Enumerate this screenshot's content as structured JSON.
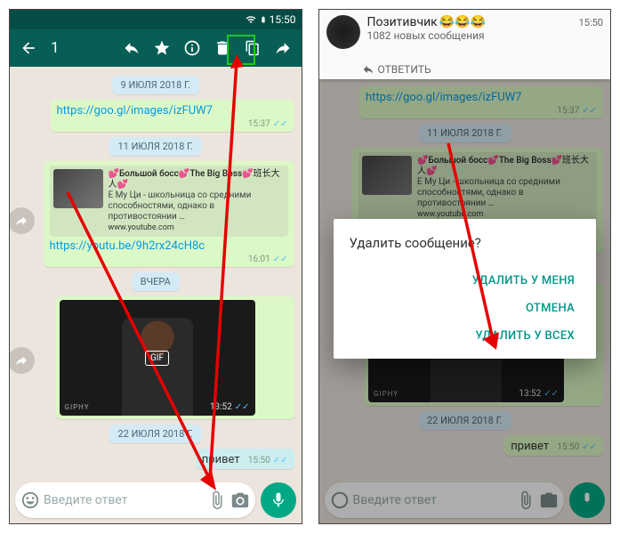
{
  "status": {
    "time": "15:50"
  },
  "actionbar": {
    "selected_count": "1"
  },
  "dates": {
    "d1": "9 ИЮЛЯ 2018 Г.",
    "d2": "11 ИЮЛЯ 2018 Г.",
    "d3": "ВЧЕРА",
    "d4": "22 ИЮЛЯ 2018 Г."
  },
  "msg1": {
    "link": "https://goo.gl/images/izFUW7",
    "time": "15:37"
  },
  "msg2": {
    "preview_title": "💕Большой босс💕The Big Boss💕班长大人💕",
    "preview_desc": "Е Му Ци - школьница со средними способностями, однако в противостоянии …",
    "preview_url": "www.youtube.com",
    "link": "https://youtu.be/9h2rx24cH8c",
    "time": "16:01"
  },
  "msg3": {
    "gif_label": "GIF",
    "giphy": "GIPHY",
    "time": "13:52"
  },
  "msg4": {
    "text": "привет",
    "time": "15:50"
  },
  "input": {
    "placeholder": "Введите ответ"
  },
  "notification": {
    "title": "Позитивчик",
    "emoji": "😂😂😂",
    "subtitle": "1082 новых сообщения",
    "time": "15:50",
    "reply": "ОТВЕТИТЬ"
  },
  "dialog": {
    "title": "Удалить сообщение?",
    "delete_me": "УДАЛИТЬ У МЕНЯ",
    "cancel": "ОТМЕНА",
    "delete_all": "УДАЛИТЬ У ВСЕХ"
  }
}
